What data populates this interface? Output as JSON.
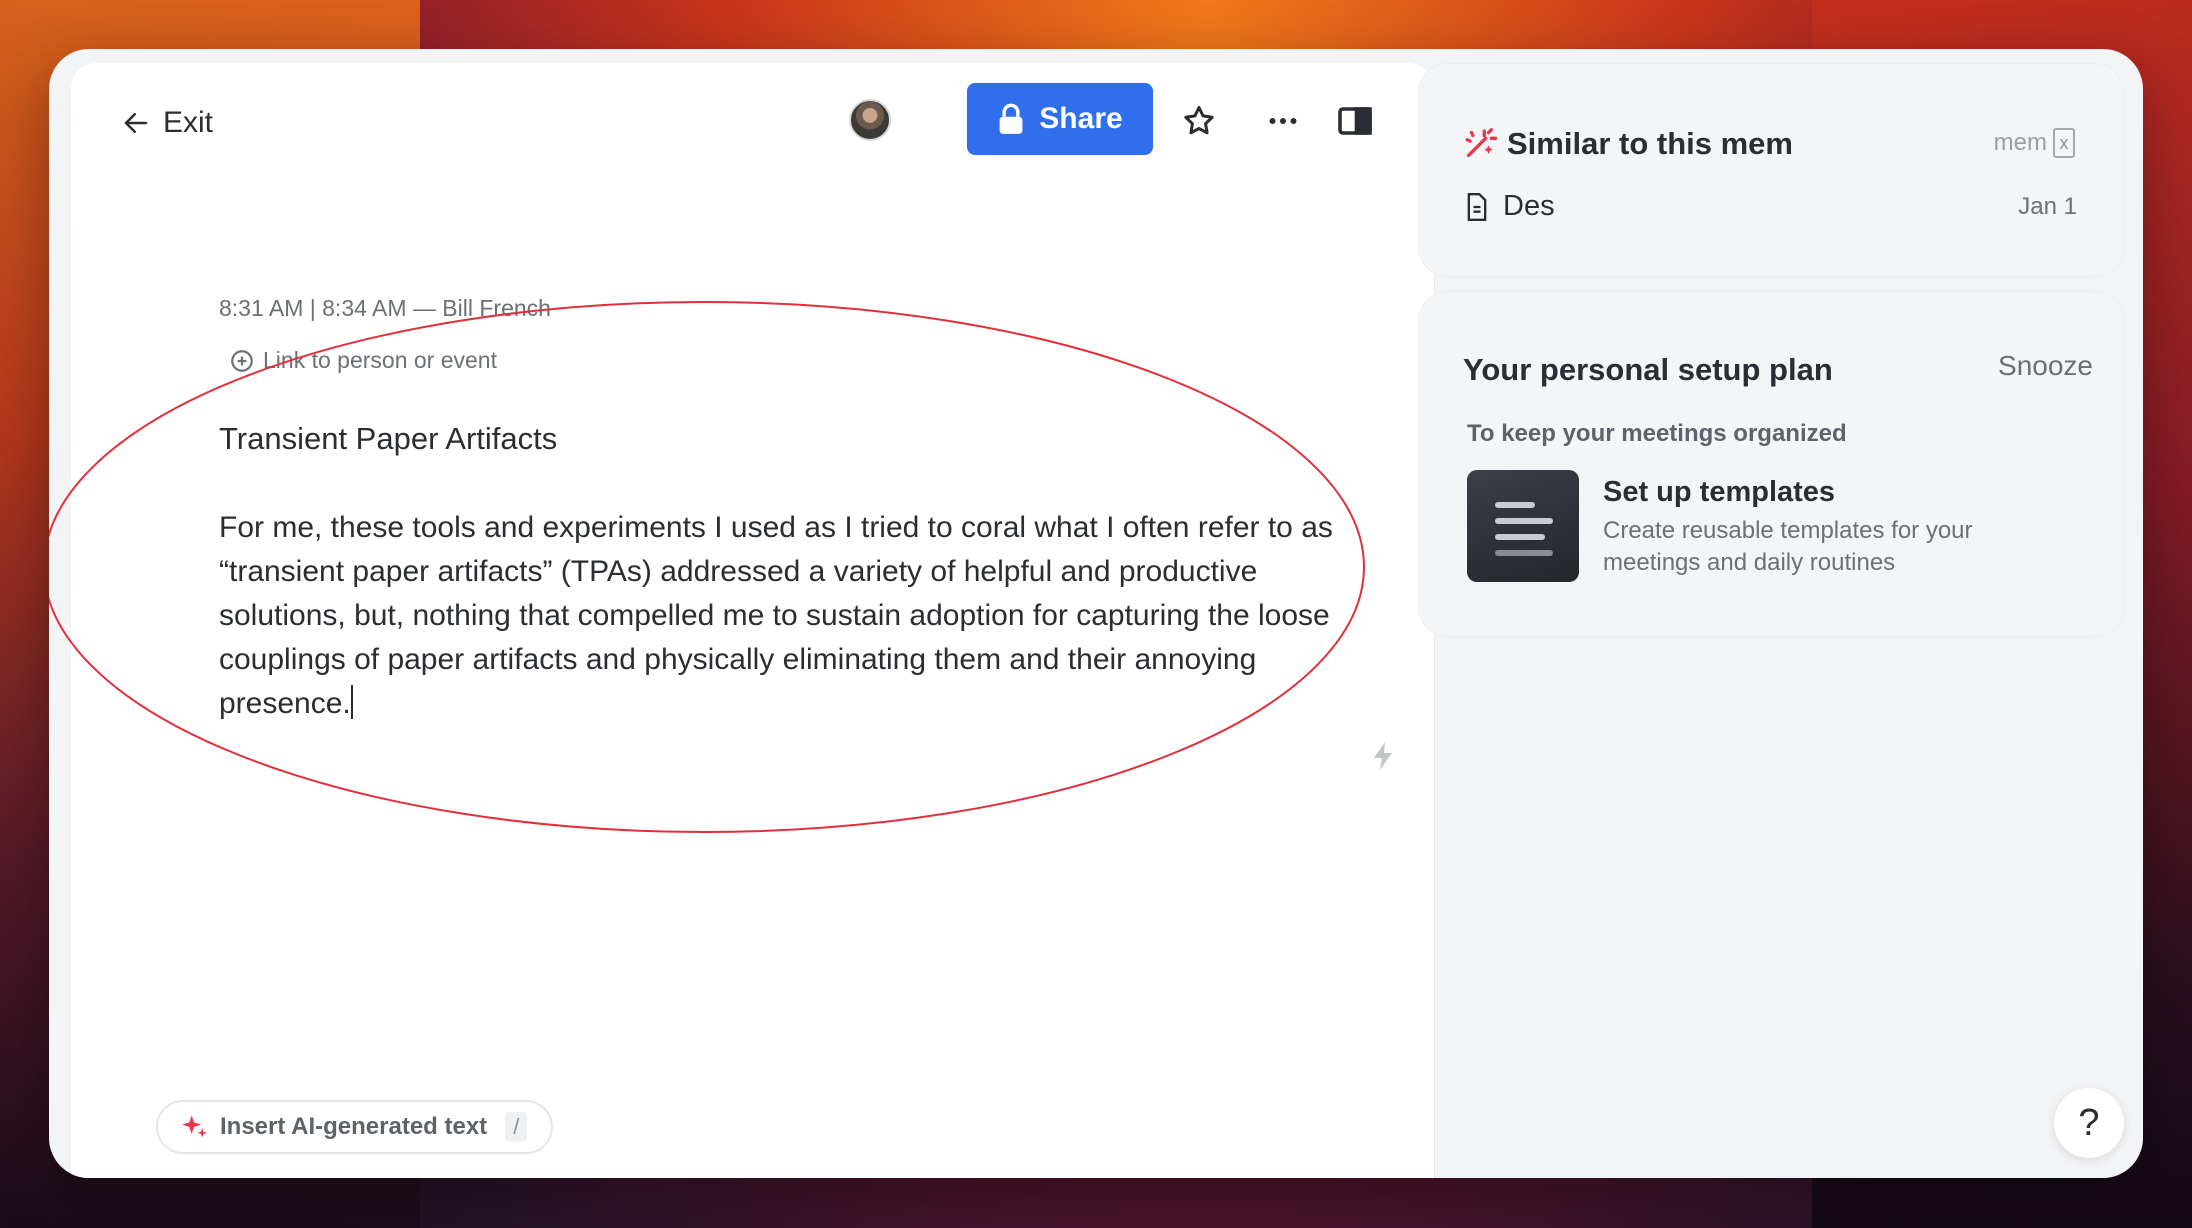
{
  "topbar": {
    "exit_label": "Exit",
    "share_label": "Share",
    "share_color": "#2f6fee"
  },
  "note": {
    "meta": "8:31 AM | 8:34 AM — Bill French",
    "link_label": "Link to person or event",
    "title": "Transient Paper Artifacts",
    "body": "For me, these tools and experiments I used as I tried to coral what I often refer to as “transient paper artifacts” (TPAs) addressed a variety of helpful and productive solutions, but, nothing that compelled me to sustain adoption for capturing the loose couplings of paper artifacts and physically eliminating them and their annoying presence."
  },
  "ai_insert": {
    "label": "Insert AI-generated text",
    "shortcut": "/"
  },
  "similar": {
    "title": "Similar to this mem",
    "brand": "mem",
    "brand_key": "x",
    "items": [
      {
        "title": "Des",
        "date": "Jan 1"
      }
    ]
  },
  "setup_plan": {
    "title": "Your personal setup plan",
    "snooze_label": "Snooze",
    "subtitle": "To keep your meetings organized",
    "task_title": "Set up templates",
    "task_desc": "Create reusable templates for your meetings and daily routines"
  },
  "help": {
    "label": "?"
  },
  "icons": [
    "arrow-left-icon",
    "avatar",
    "lock-icon",
    "star-icon",
    "more-icon",
    "panel-icon",
    "plus-circle-icon",
    "bolt-icon",
    "sparkle-icon",
    "magic-wand-icon",
    "document-icon",
    "template-icon"
  ],
  "colors": {
    "accent": "#2f6fee",
    "annotation": "#e0313a",
    "wand": "#e8384f"
  }
}
